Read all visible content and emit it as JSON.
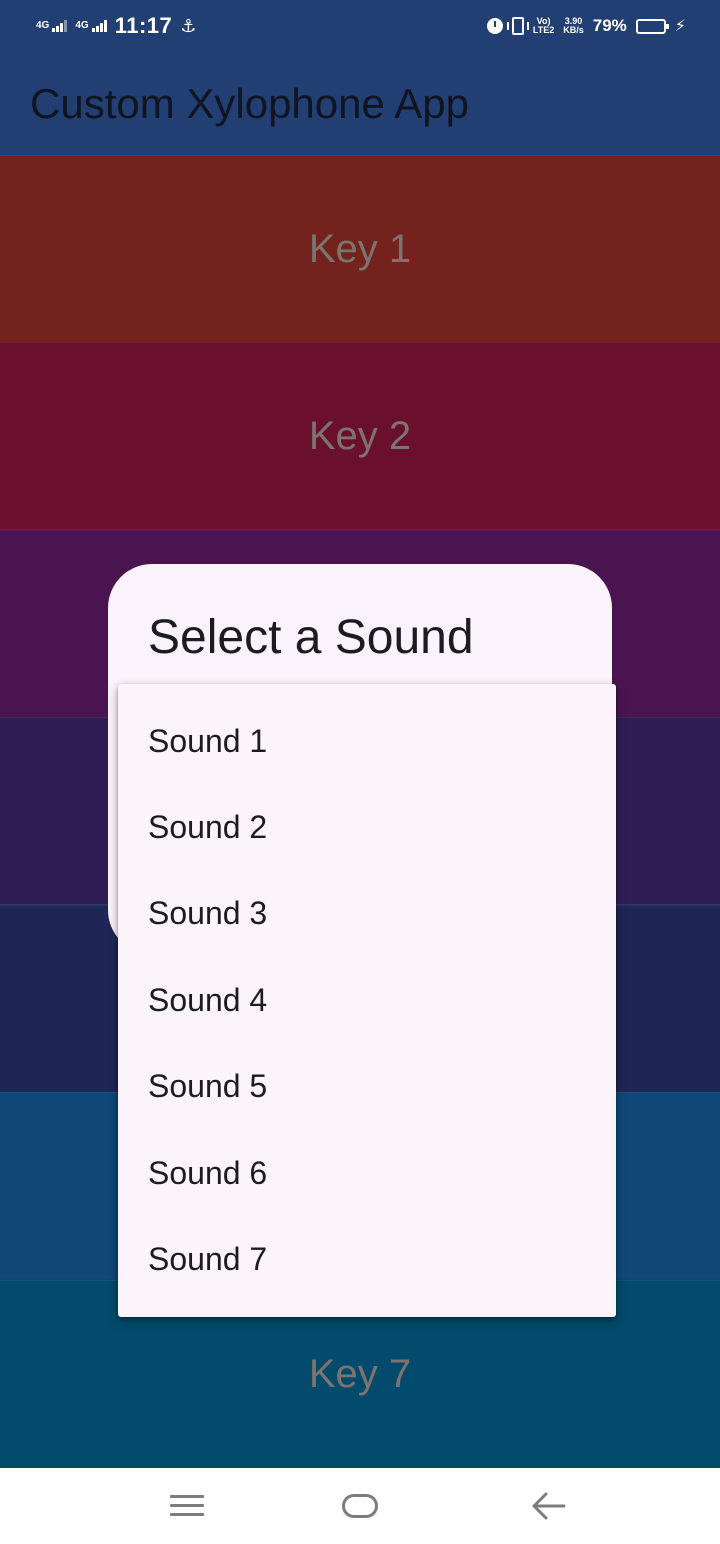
{
  "status_bar": {
    "net1": "4G",
    "net2": "4G",
    "time": "11:17",
    "volte_line1": "Vo)",
    "volte_line2": "LTE2",
    "speed_value": "3.90",
    "speed_unit": "KB/s",
    "battery_percent": "79%",
    "battery_level": 0.79,
    "icons": [
      "usb-icon",
      "alarm-icon",
      "vibrate-icon",
      "battery-icon",
      "charging-icon"
    ]
  },
  "app_bar": {
    "title": "Custom Xylophone App"
  },
  "keys": [
    {
      "label": "Key 1",
      "color": "#73221d"
    },
    {
      "label": "Key 2",
      "color": "#6b0f2f"
    },
    {
      "label": "",
      "color": "#4a1450"
    },
    {
      "label": "",
      "color": "#2f1d54"
    },
    {
      "label": "",
      "color": "#1f2656"
    },
    {
      "label": "",
      "color": "#0f4877"
    },
    {
      "label": "Key 7",
      "color": "#034b6c"
    }
  ],
  "dialog": {
    "title": "Select a Sound",
    "options": [
      "Sound 1",
      "Sound 2",
      "Sound 3",
      "Sound 4",
      "Sound 5",
      "Sound 6",
      "Sound 7"
    ]
  },
  "nav_bar": {
    "icons": [
      "menu-icon",
      "home-icon",
      "back-icon"
    ]
  }
}
